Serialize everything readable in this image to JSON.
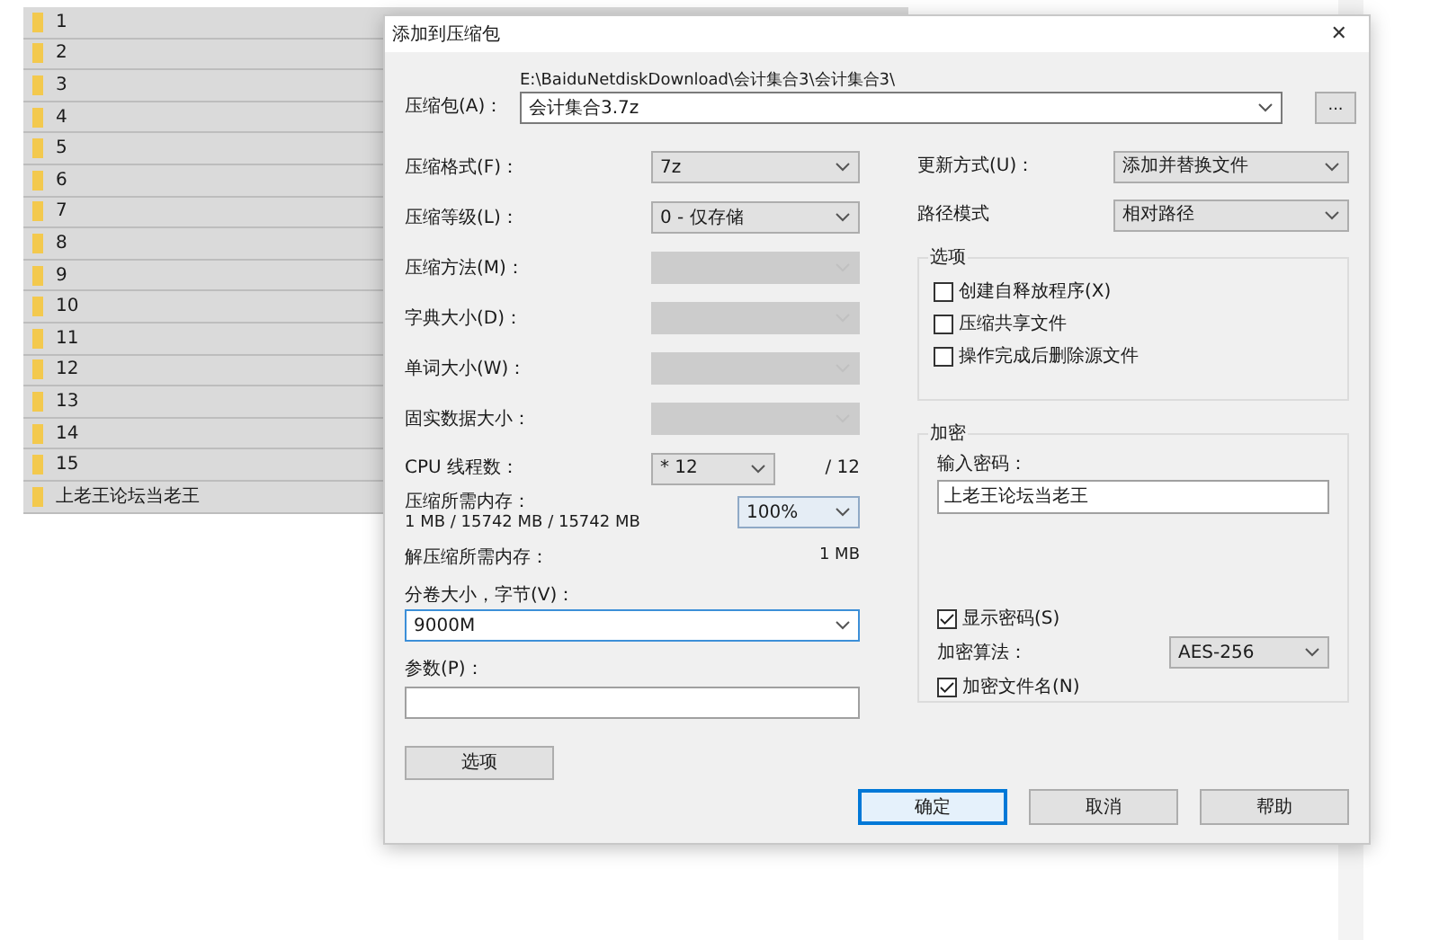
{
  "file_list": [
    {
      "name": "1"
    },
    {
      "name": "2"
    },
    {
      "name": "3"
    },
    {
      "name": "4"
    },
    {
      "name": "5"
    },
    {
      "name": "6"
    },
    {
      "name": "7"
    },
    {
      "name": "8"
    },
    {
      "name": "9"
    },
    {
      "name": "10"
    },
    {
      "name": "11"
    },
    {
      "name": "12"
    },
    {
      "name": "13"
    },
    {
      "name": "14"
    },
    {
      "name": "15"
    },
    {
      "name": "上老王论坛当老王"
    }
  ],
  "dialog": {
    "title": "添加到压缩包",
    "close": "✕",
    "archive": {
      "label": "压缩包(A)：",
      "path": "E:\\BaiduNetdiskDownload\\会计集合3\\会计集合3\\",
      "value": "会计集合3.7z",
      "browse": "..."
    },
    "left_settings": [
      {
        "label": "压缩格式(F)：",
        "value": "7z",
        "disabled": false
      },
      {
        "label": "压缩等级(L)：",
        "value": "0 - 仅存储",
        "disabled": false
      },
      {
        "label": "压缩方法(M)：",
        "disabled": true
      },
      {
        "label": "字典大小(D)：",
        "disabled": true
      },
      {
        "label": "单词大小(W)：",
        "disabled": true
      },
      {
        "label": "固实数据大小：",
        "disabled": true
      }
    ],
    "cpu": {
      "label": "CPU 线程数：",
      "value": "* 12",
      "total": "/ 12"
    },
    "memory": {
      "label": "压缩所需内存：",
      "detail": "1 MB / 15742 MB / 15742 MB",
      "value": "100%"
    },
    "decompress_memory": {
      "label": "解压缩所需内存：",
      "value": "1 MB"
    },
    "volume": {
      "label": "分卷大小，字节(V)：",
      "value": "9000M"
    },
    "params": {
      "label": "参数(P)："
    },
    "options_button": "选项",
    "right_settings": [
      {
        "label": "更新方式(U)：",
        "value": "添加并替换文件"
      },
      {
        "label": "路径模式",
        "value": "相对路径"
      }
    ],
    "options_group": {
      "title": "选项",
      "items": [
        {
          "label": "创建自释放程序(X)",
          "checked": false
        },
        {
          "label": "压缩共享文件",
          "checked": false
        },
        {
          "label": "操作完成后删除源文件",
          "checked": false
        }
      ]
    },
    "encryption": {
      "title": "加密",
      "password_label": "输入密码：",
      "password": "上老王论坛当老王",
      "show_password": {
        "label": "显示密码(S)",
        "checked": true
      },
      "method_label": "加密算法：",
      "method": "AES-256",
      "encrypt_names": {
        "label": "加密文件名(N)",
        "checked": true
      }
    },
    "buttons": [
      {
        "label": "确定",
        "selected": true
      },
      {
        "label": "取消",
        "selected": false
      },
      {
        "label": "帮助",
        "selected": false
      }
    ]
  }
}
